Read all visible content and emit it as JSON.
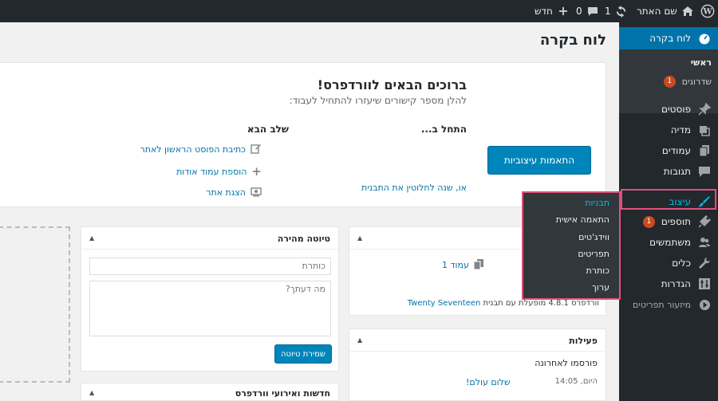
{
  "adminbar": {
    "site_name": "שם האתר",
    "updates_count": "1",
    "comments_count": "0",
    "new_label": "חדש"
  },
  "sidebar": {
    "dashboard": "לוח בקרה",
    "home": "ראשי",
    "updates": "שדרוגים",
    "updates_badge": "1",
    "posts": "פוסטים",
    "media": "מדיה",
    "pages": "עמודים",
    "comments": "תגובות",
    "appearance": "עיצוב",
    "plugins": "תוספים",
    "plugins_badge": "1",
    "users": "משתמשים",
    "tools": "כלים",
    "settings": "הגדרות",
    "collapse": "מיזעור תפריטים"
  },
  "flyout": {
    "themes": "תבניות",
    "customize": "התאמה אישית",
    "widgets": "ווידג'טים",
    "menus": "תפריטים",
    "header": "כותרת",
    "editor": "ערוך"
  },
  "page": {
    "title": "לוח בקרה"
  },
  "welcome": {
    "heading": "ברוכים הבאים לוורדפרס!",
    "subheading": "להלן מספר קישורים שיעזרו להתחיל לעבוד:",
    "get_started": "התחל ב...",
    "customize_button": "התאמות עיצוביות",
    "or_change_theme": "או, שנה לחלוטין את התבנית",
    "next_steps": "שלב הבא",
    "write_first_post": "כתיבת הפוסט הראשון לאתר",
    "add_about_page": "הוספת עמוד אודות",
    "view_site": "הצגת אתר"
  },
  "at_a_glance": {
    "pages_count": "עמוד 1",
    "version_text": "וורדפרס 4.8.1 מופעלת עם תבנית",
    "theme_name": "Twenty Seventeen"
  },
  "activity": {
    "title": "פעילות",
    "recently_published": "פורסמו לאחרונה",
    "date": "היום, 14:05",
    "post_title": "שלום עולם!"
  },
  "quick_draft": {
    "title": "טיוטה מהירה",
    "title_placeholder": "כותרת",
    "content_placeholder": "מה דעתך?",
    "save_button": "שמירת טיוטה"
  },
  "news": {
    "title": "חדשות ואירועי וורדפרס"
  }
}
